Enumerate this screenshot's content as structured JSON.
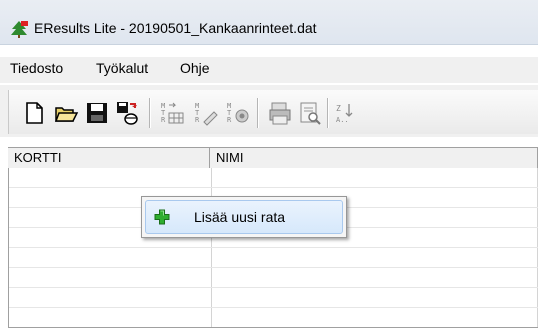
{
  "window": {
    "title": "EResults Lite - 20190501_Kankaanrinteet.dat"
  },
  "menubar": {
    "items": [
      "Tiedosto",
      "Työkalut",
      "Ohje"
    ]
  },
  "toolbar": {
    "icons": [
      "new-file-icon",
      "open-folder-icon",
      "save-icon",
      "save-export-icon",
      "table-import-icon",
      "edit-control-icon",
      "control-settings-icon",
      "printer-icon",
      "print-preview-icon",
      "sort-icon"
    ]
  },
  "grid": {
    "columns": [
      "KORTTI",
      "NIMI"
    ]
  },
  "context_menu": {
    "items": [
      {
        "label": "Lisää uusi rata",
        "icon": "green-plus-icon"
      }
    ]
  },
  "colors": {
    "accent": "#d6e8fb",
    "plus": "#2fae2f"
  }
}
